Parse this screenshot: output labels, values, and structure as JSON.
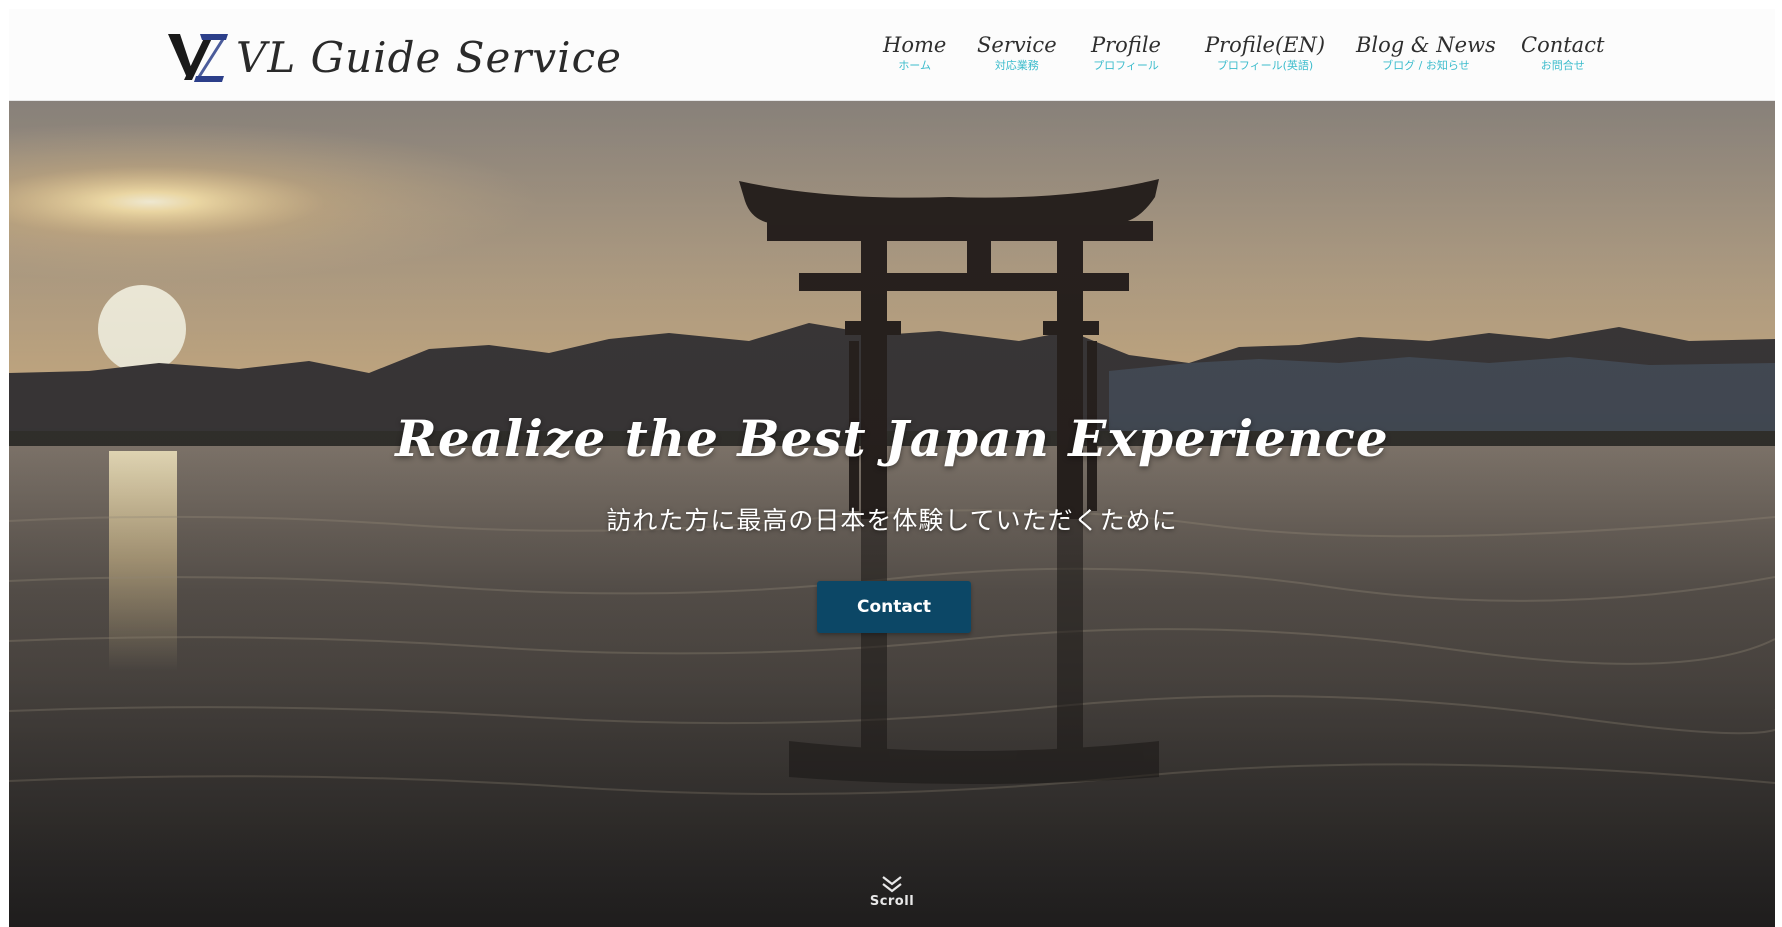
{
  "brand": {
    "name": "VL Guide Service",
    "logo_letters": "VZ"
  },
  "nav": {
    "items": [
      {
        "label": "Home",
        "sub": "ホーム"
      },
      {
        "label": "Service",
        "sub": "対応業務"
      },
      {
        "label": "Profile",
        "sub": "プロフィール"
      },
      {
        "label": "Profile(EN)",
        "sub": "プロフィール(英語)"
      },
      {
        "label": "Blog & News",
        "sub": "ブログ / お知らせ"
      },
      {
        "label": "Contact",
        "sub": "お問合せ"
      }
    ]
  },
  "hero": {
    "title": "Realize the Best Japan Experience",
    "subtitle": "訪れた方に最高の日本を体験していただくために",
    "cta_label": "Contact",
    "scroll_label": "Scroll"
  },
  "colors": {
    "accent": "#3cbccc",
    "cta": "#0c4766",
    "logo_dark": "#1a1a1a",
    "logo_blue": "#2c3f8a"
  }
}
